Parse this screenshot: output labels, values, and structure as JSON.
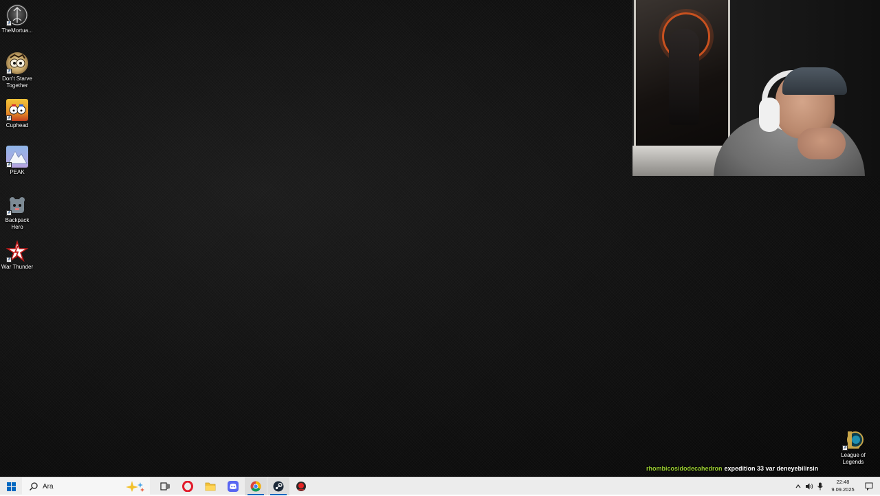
{
  "desktop": {
    "icons": [
      {
        "label": "TheMortua...",
        "icon": "mortuary-assistant-icon"
      },
      {
        "label": "Don't Starve Together",
        "icon": "dont-starve-together-icon"
      },
      {
        "label": "Cuphead",
        "icon": "cuphead-icon"
      },
      {
        "label": "PEAK",
        "icon": "peak-icon"
      },
      {
        "label": "Backpack Hero",
        "icon": "backpack-hero-icon"
      },
      {
        "label": "War Thunder",
        "icon": "war-thunder-icon"
      }
    ],
    "right_icon": {
      "label": "League of Legends",
      "icon": "league-of-legends-icon"
    }
  },
  "chat": {
    "username": "rhombicosidodecahedron",
    "message": "expedition 33 var deneyebilirsin",
    "username_color": "#9acd32"
  },
  "taskbar": {
    "search_placeholder": "Ara",
    "apps": [
      {
        "name": "task-view",
        "icon": "task-view-icon"
      },
      {
        "name": "opera",
        "icon": "opera-icon"
      },
      {
        "name": "file-explorer",
        "icon": "folder-icon"
      },
      {
        "name": "discord",
        "icon": "discord-icon"
      },
      {
        "name": "chrome",
        "icon": "chrome-icon"
      },
      {
        "name": "steam",
        "icon": "steam-icon"
      },
      {
        "name": "obs-like",
        "icon": "record-app-icon"
      }
    ],
    "clock": {
      "time": "22:48",
      "date": "9.09.2025"
    },
    "accent": "#0067c0"
  }
}
